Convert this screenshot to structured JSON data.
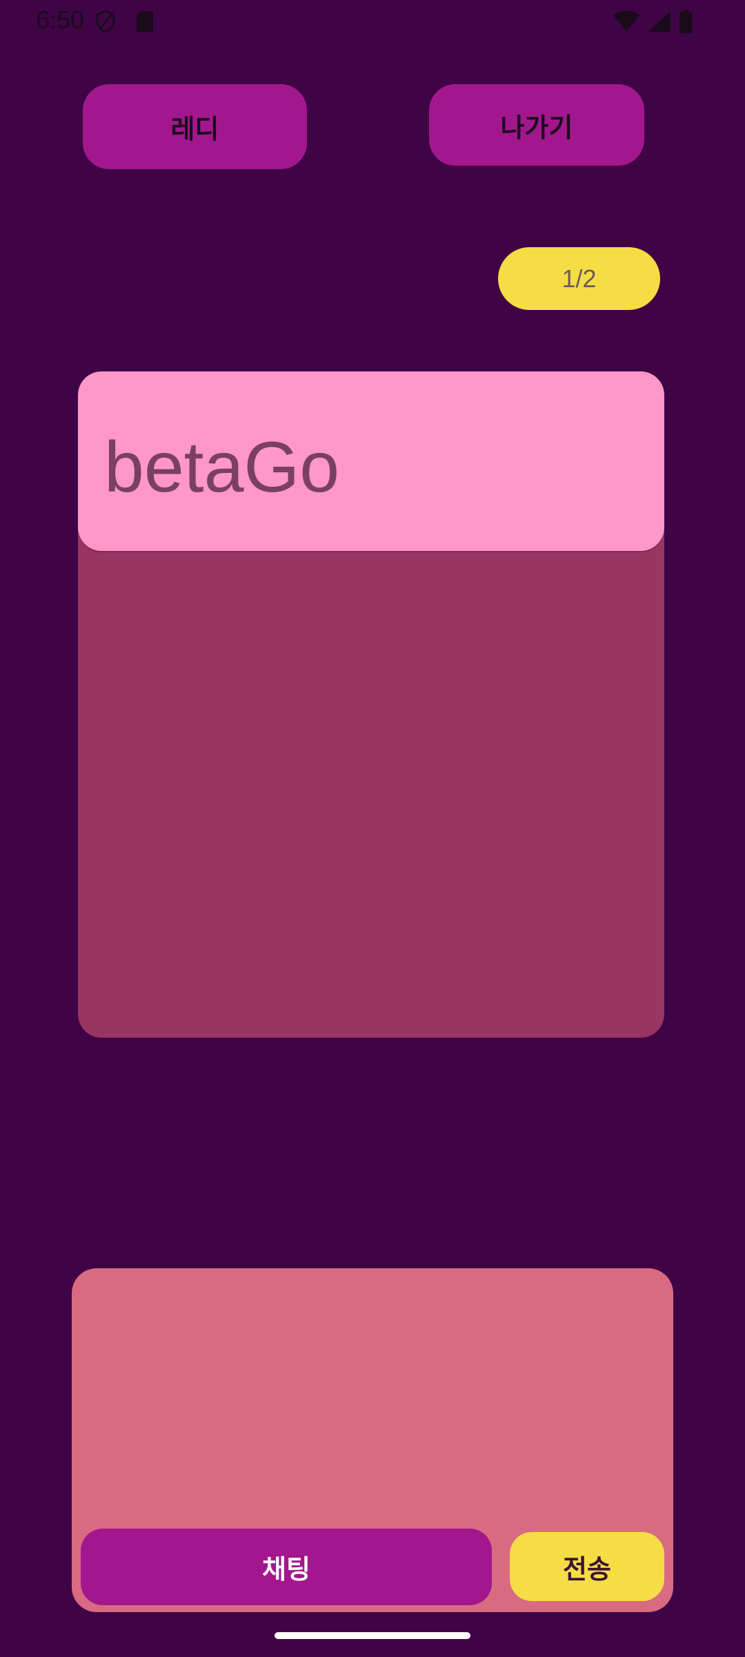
{
  "status_bar": {
    "time": "6:50",
    "icons": [
      "shield-icon",
      "sdcard-icon",
      "wifi-icon",
      "signal-icon",
      "battery-icon"
    ]
  },
  "top_actions": {
    "ready_label": "레디",
    "exit_label": "나가기"
  },
  "player_counter": "1/2",
  "player_card": {
    "name": "betaGo"
  },
  "chat": {
    "chat_label": "채팅",
    "send_label": "전송"
  },
  "colors": {
    "background": "#3f0445",
    "button_purple": "#a3178e",
    "accent_yellow": "#f5de45",
    "card_header_pink": "#ff97c9",
    "card_body": "#983563",
    "chat_panel": "#d86b82"
  }
}
